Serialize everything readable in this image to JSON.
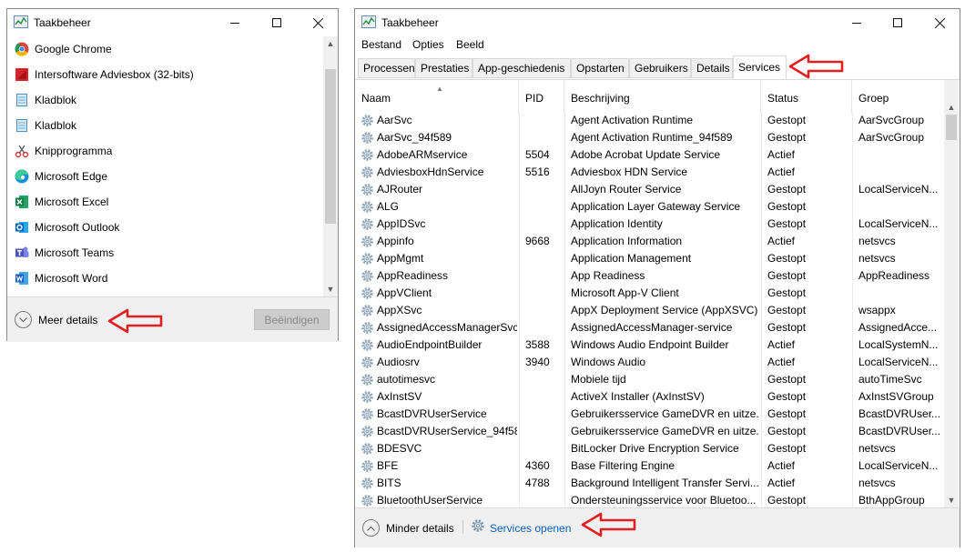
{
  "left_window": {
    "title": "Taakbeheer",
    "apps": [
      {
        "name": "Google Chrome",
        "icon": "chrome-icon"
      },
      {
        "name": "Intersoftware Adviesbox (32-bits)",
        "icon": "adviesbox-icon"
      },
      {
        "name": "Kladblok",
        "icon": "notepad-icon"
      },
      {
        "name": "Kladblok",
        "icon": "notepad-icon"
      },
      {
        "name": "Knipprogramma",
        "icon": "snipping-tool-icon"
      },
      {
        "name": "Microsoft Edge",
        "icon": "edge-icon"
      },
      {
        "name": "Microsoft Excel",
        "icon": "excel-icon"
      },
      {
        "name": "Microsoft Outlook",
        "icon": "outlook-icon"
      },
      {
        "name": "Microsoft Teams",
        "icon": "teams-icon"
      },
      {
        "name": "Microsoft Word",
        "icon": "word-icon"
      }
    ],
    "more_details": "Meer details",
    "end_task": "Beëindigen"
  },
  "right_window": {
    "title": "Taakbeheer",
    "menu": [
      "Bestand",
      "Opties",
      "Beeld"
    ],
    "tabs": [
      "Processen",
      "Prestaties",
      "App-geschiedenis",
      "Opstarten",
      "Gebruikers",
      "Details",
      "Services"
    ],
    "active_tab": "Services",
    "columns": [
      "Naam",
      "PID",
      "Beschrijving",
      "Status",
      "Groep"
    ],
    "rows": [
      [
        "AarSvc",
        "",
        "Agent Activation Runtime",
        "Gestopt",
        "AarSvcGroup"
      ],
      [
        "AarSvc_94f589",
        "",
        "Agent Activation Runtime_94f589",
        "Gestopt",
        "AarSvcGroup"
      ],
      [
        "AdobeARMservice",
        "5504",
        "Adobe Acrobat Update Service",
        "Actief",
        ""
      ],
      [
        "AdviesboxHdnService",
        "5516",
        "Adviesbox HDN Service",
        "Actief",
        ""
      ],
      [
        "AJRouter",
        "",
        "AllJoyn Router Service",
        "Gestopt",
        "LocalServiceN..."
      ],
      [
        "ALG",
        "",
        "Application Layer Gateway Service",
        "Gestopt",
        ""
      ],
      [
        "AppIDSvc",
        "",
        "Application Identity",
        "Gestopt",
        "LocalServiceN..."
      ],
      [
        "Appinfo",
        "9668",
        "Application Information",
        "Actief",
        "netsvcs"
      ],
      [
        "AppMgmt",
        "",
        "Application Management",
        "Gestopt",
        "netsvcs"
      ],
      [
        "AppReadiness",
        "",
        "App Readiness",
        "Gestopt",
        "AppReadiness"
      ],
      [
        "AppVClient",
        "",
        "Microsoft App-V Client",
        "Gestopt",
        ""
      ],
      [
        "AppXSvc",
        "",
        "AppX Deployment Service (AppXSVC)",
        "Gestopt",
        "wsappx"
      ],
      [
        "AssignedAccessManagerSvc",
        "",
        "AssignedAccessManager-service",
        "Gestopt",
        "AssignedAcce..."
      ],
      [
        "AudioEndpointBuilder",
        "3588",
        "Windows Audio Endpoint Builder",
        "Actief",
        "LocalSystemN..."
      ],
      [
        "Audiosrv",
        "3940",
        "Windows Audio",
        "Actief",
        "LocalServiceN..."
      ],
      [
        "autotimesvc",
        "",
        "Mobiele tijd",
        "Gestopt",
        "autoTimeSvc"
      ],
      [
        "AxInstSV",
        "",
        "ActiveX Installer (AxInstSV)",
        "Gestopt",
        "AxInstSVGroup"
      ],
      [
        "BcastDVRUserService",
        "",
        "Gebruikersservice GameDVR en uitze...",
        "Gestopt",
        "BcastDVRUser..."
      ],
      [
        "BcastDVRUserService_94f589",
        "",
        "Gebruikersservice GameDVR en uitze...",
        "Gestopt",
        "BcastDVRUser..."
      ],
      [
        "BDESVC",
        "",
        "BitLocker Drive Encryption Service",
        "Gestopt",
        "netsvcs"
      ],
      [
        "BFE",
        "4360",
        "Base Filtering Engine",
        "Actief",
        "LocalServiceN..."
      ],
      [
        "BITS",
        "4788",
        "Background Intelligent Transfer Servi...",
        "Actief",
        "netsvcs"
      ],
      [
        "BluetoothUserService",
        "",
        "Ondersteuningsservice voor Bluetoo...",
        "Gestopt",
        "BthAppGroup"
      ]
    ],
    "fewer_details": "Minder details",
    "open_services": "Services openen"
  },
  "colors": {
    "arrow": "#e02020",
    "link": "#0a5fbd"
  }
}
